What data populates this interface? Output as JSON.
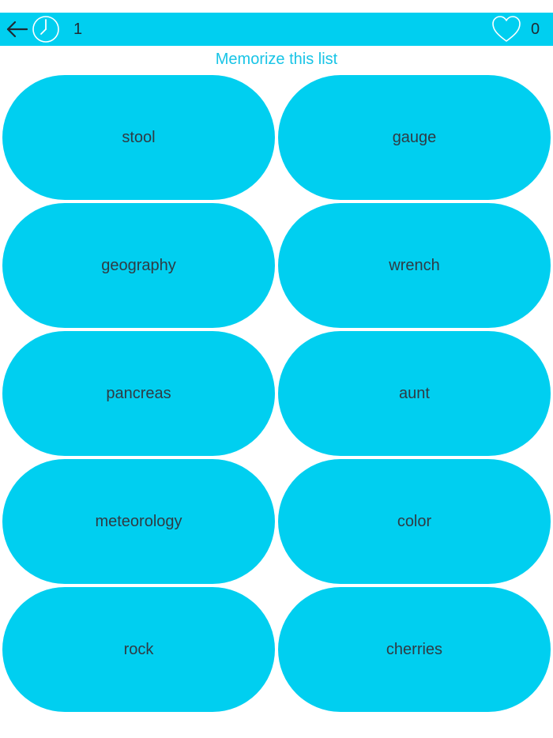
{
  "header": {
    "back_icon": "arrow-left-icon",
    "timer_icon": "clock-icon",
    "timer_value": "1",
    "lives_icon": "heart-outline-icon",
    "score_value": "0",
    "accent_color": "#00cff0"
  },
  "instruction": "Memorize this list",
  "words": [
    "stool",
    "gauge",
    "geography",
    "wrench",
    "pancreas",
    "aunt",
    "meteorology",
    "color",
    "rock",
    "cherries"
  ]
}
